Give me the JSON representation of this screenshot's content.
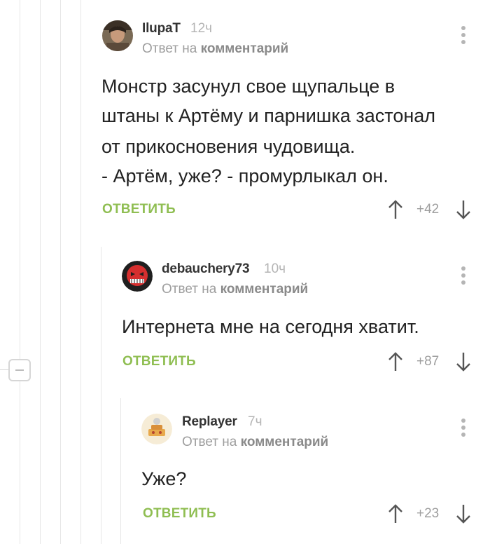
{
  "comments": [
    {
      "author": "IlupaT",
      "time": "12ч",
      "reply_prefix": "Ответ на",
      "reply_target": "комментарий",
      "lines": [
        "Монстр засунул свое щупальце в",
        "штаны к Артёму и парнишка застонал",
        "от прикосновения чудовища.",
        "- Артём, уже? - промурлыкал он."
      ],
      "reply_label": "ОТВЕТИТЬ",
      "rating": "+42"
    },
    {
      "author": "debauchery73",
      "time": "10ч",
      "reply_prefix": "Ответ на",
      "reply_target": "комментарий",
      "lines": [
        "Интернета мне на сегодня хватит."
      ],
      "reply_label": "ОТВЕТИТЬ",
      "rating": "+87"
    },
    {
      "author": "Replayer",
      "time": "7ч",
      "reply_prefix": "Ответ на",
      "reply_target": "комментарий",
      "lines": [
        "Уже?"
      ],
      "reply_label": "ОТВЕТИТЬ",
      "rating": "+23"
    }
  ],
  "icons": {
    "more": "more-vertical-icon",
    "upvote": "arrow-up-icon",
    "downvote": "arrow-down-icon",
    "collapse": "collapse-minus-icon"
  },
  "colors": {
    "accent_green": "#8fbe52",
    "muted_text": "#9e9e9e",
    "thread_line": "#e6e6e6"
  }
}
